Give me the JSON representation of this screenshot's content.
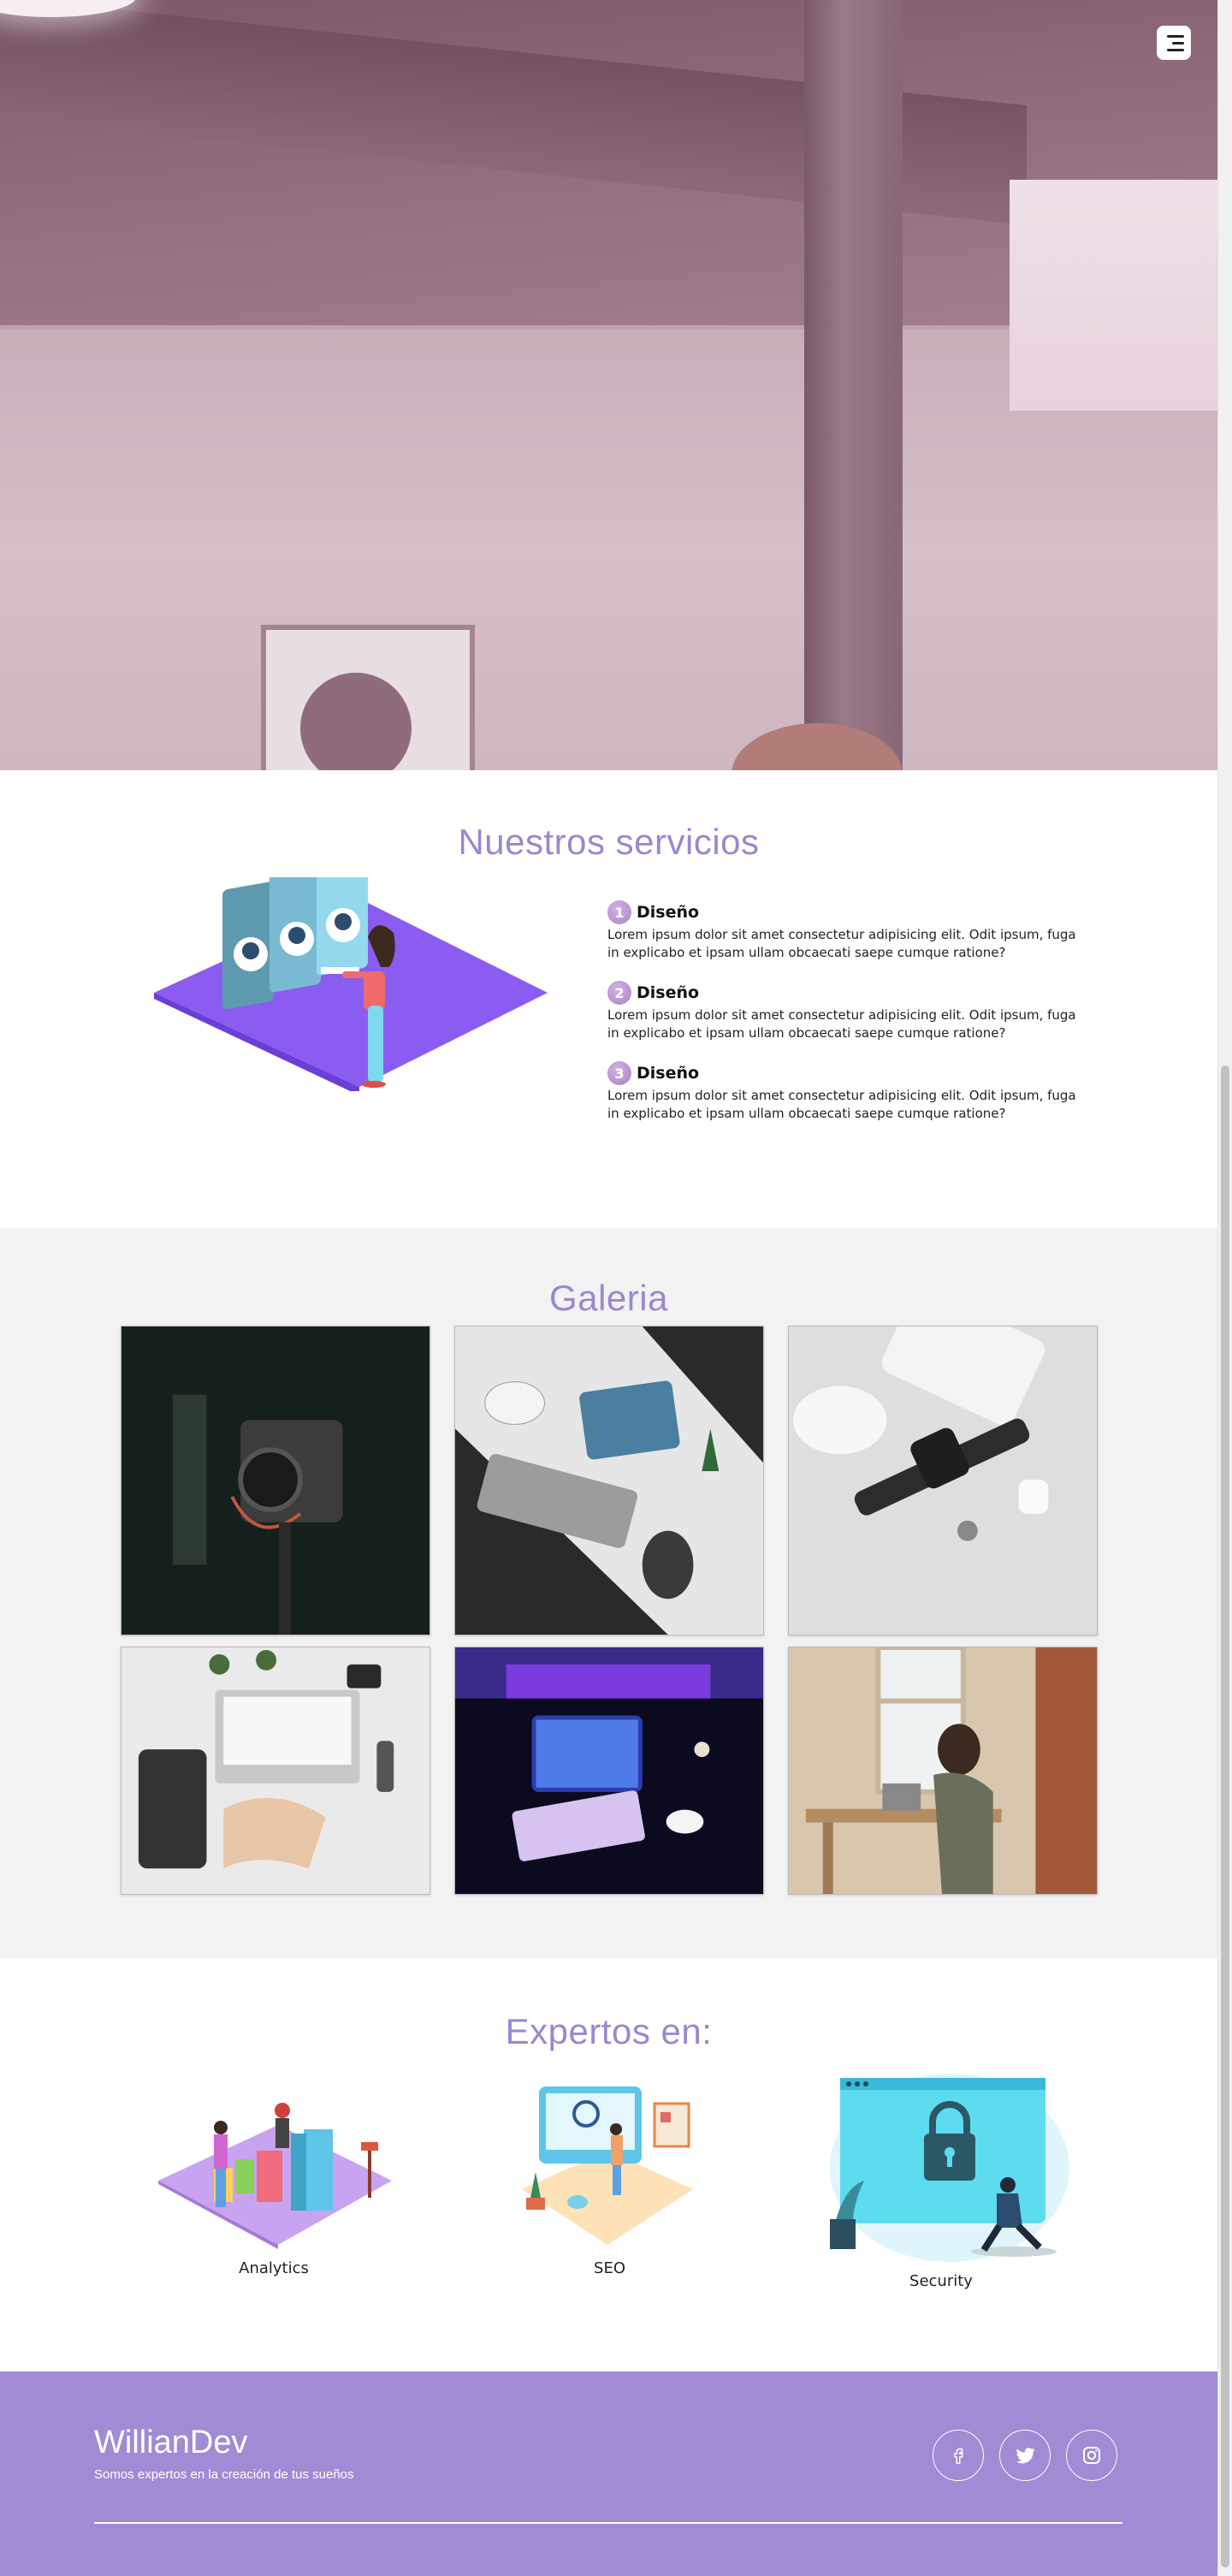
{
  "header": {
    "menu_icon": "hamburger-menu-icon"
  },
  "services": {
    "title": "Nuestros servicios",
    "items": [
      {
        "number": "1",
        "title": "Diseño",
        "desc": "Lorem ipsum dolor sit amet consectetur adipisicing elit. Odit ipsum, fuga in explicabo et ipsam ullam obcaecati saepe cumque ratione?"
      },
      {
        "number": "2",
        "title": "Diseño",
        "desc": "Lorem ipsum dolor sit amet consectetur adipisicing elit. Odit ipsum, fuga in explicabo et ipsam ullam obcaecati saepe cumque ratione?"
      },
      {
        "number": "3",
        "title": "Diseño",
        "desc": "Lorem ipsum dolor sit amet consectetur adipisicing elit. Odit ipsum, fuga in explicabo et ipsam ullam obcaecati saepe cumque ratione?"
      }
    ]
  },
  "gallery": {
    "title": "Galeria",
    "images": [
      "camera-photo",
      "desk-setup-photo",
      "gaming-accessories-photo",
      "laptop-work-photo",
      "neon-tablet-photo",
      "man-laptop-photo"
    ]
  },
  "experts": {
    "title": "Expertos en:",
    "items": [
      {
        "label": "Analytics"
      },
      {
        "label": "SEO"
      },
      {
        "label": "Security"
      }
    ]
  },
  "footer": {
    "brand": "WillianDev",
    "tagline": "Somos expertos en la creación de tus sueños",
    "socials": [
      "facebook-icon",
      "twitter-icon",
      "instagram-icon"
    ]
  },
  "colors": {
    "accent": "#9b87cf",
    "footer_bg": "#a08bd4",
    "gallery_bg": "#f2f2f2"
  }
}
